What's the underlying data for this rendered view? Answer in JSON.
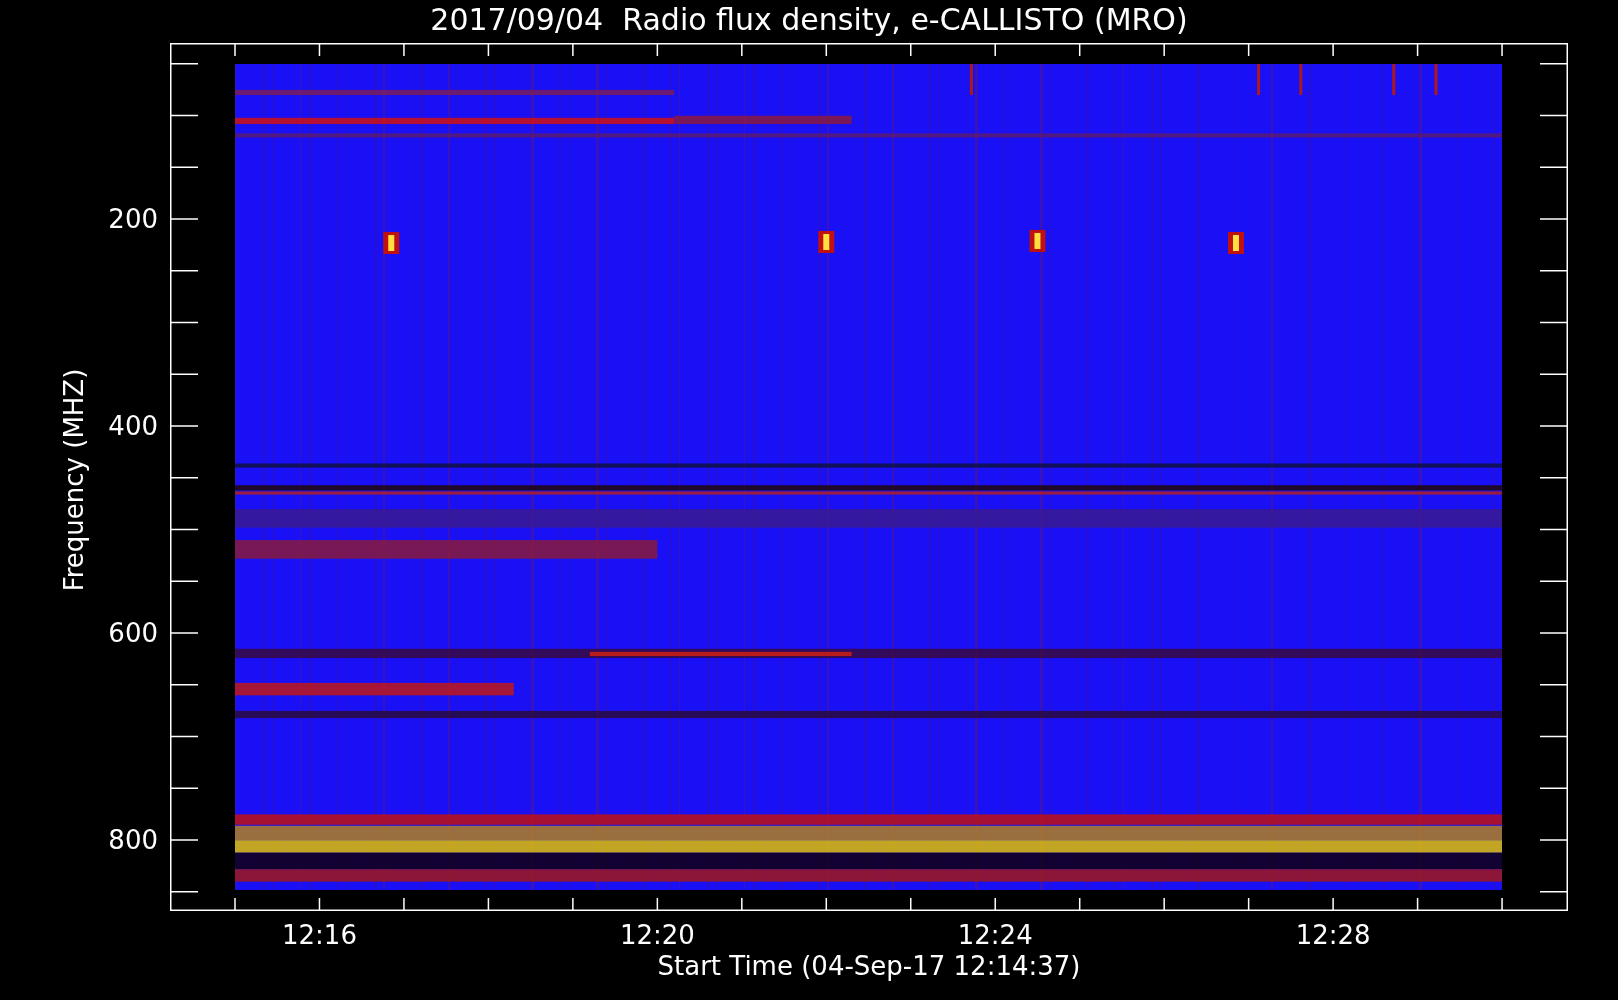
{
  "title": "2017/09/04  Radio flux density, e-CALLISTO (MRO)",
  "y_axis": {
    "label": "Frequency (MHZ)",
    "ticks": [
      "200",
      "400",
      "600",
      "800"
    ]
  },
  "x_axis": {
    "label": "Start Time (04-Sep-17 12:14:37)",
    "ticks": [
      "12:16",
      "12:20",
      "12:24",
      "12:28"
    ]
  }
}
